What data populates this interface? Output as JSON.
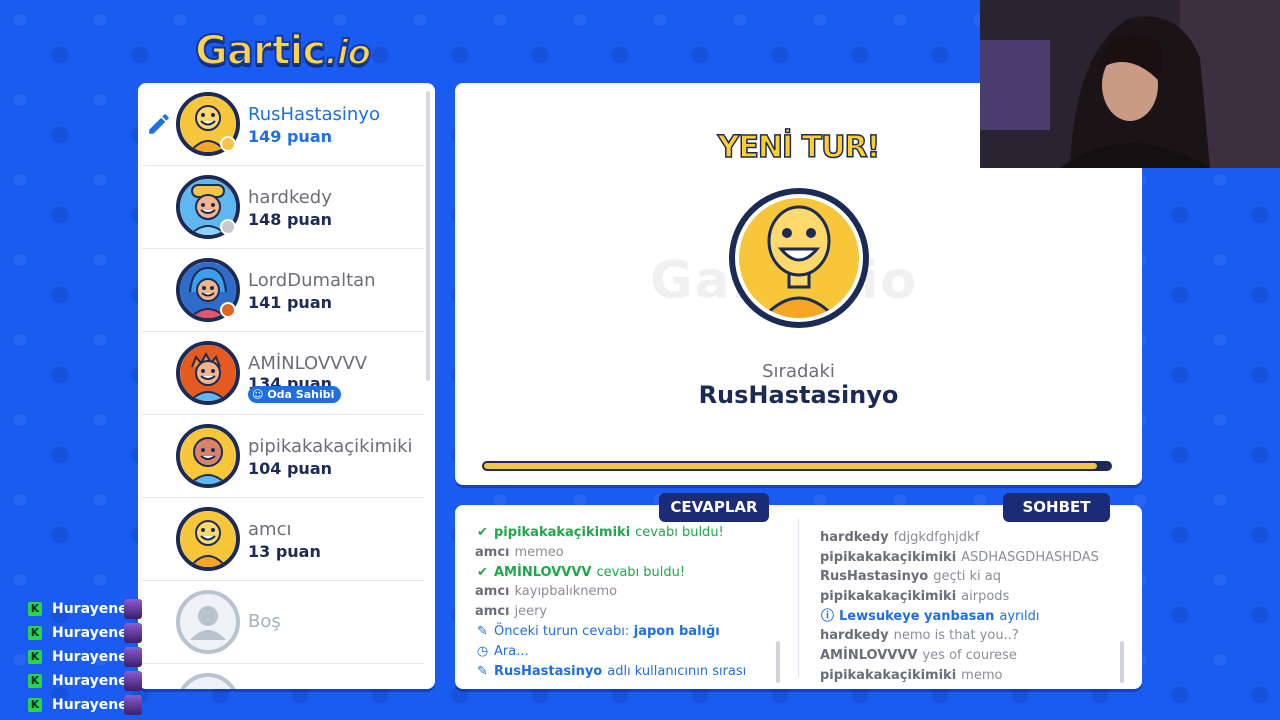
{
  "logo": {
    "text": "Gartic",
    "suffix": ".io"
  },
  "players": [
    {
      "name": "RusHastasinyo",
      "score": "149 puan",
      "drawing": true,
      "me": true,
      "avatar_color": "#f7c63b",
      "status_color": "#f4c542"
    },
    {
      "name": "hardkedy",
      "score": "148 puan",
      "avatar_color": "#5fb7ef",
      "status_color": "#c7c9cf"
    },
    {
      "name": "LordDumaltan",
      "score": "141 puan",
      "avatar_color": "#3b7fd6",
      "status_color": "#e0661f"
    },
    {
      "name": "AMİNLOVVVV",
      "score": "134 puan",
      "badge": "Oda Sahibi",
      "avatar_color": "#f08a2c"
    },
    {
      "name": "pipikakakaçikimiki",
      "score": "104 puan",
      "avatar_color": "#d9846a"
    },
    {
      "name": "amcı",
      "score": "13 puan",
      "avatar_color": "#f7c63b"
    },
    {
      "name": "Boş",
      "empty": true
    }
  ],
  "round": {
    "title": "YENİ TUR!",
    "next_label": "Sıradaki",
    "next_name": "RusHastasinyo",
    "progress": 0.98
  },
  "answers": {
    "label": "CEVAPLAR",
    "messages": [
      {
        "type": "success",
        "user": "pipikakakaçikimiki",
        "text": "cevabı buldu!"
      },
      {
        "type": "normal",
        "user": "amcı",
        "text": "memeo"
      },
      {
        "type": "success",
        "user": "AMİNLOVVVV",
        "text": "cevabı buldu!"
      },
      {
        "type": "normal",
        "user": "amcı",
        "text": "kayıpbalıknemo"
      },
      {
        "type": "normal",
        "user": "amcı",
        "text": "jeery"
      },
      {
        "type": "info-pencil",
        "text": "Önceki turun cevabı:",
        "strong": "japon balığı"
      },
      {
        "type": "info-clock",
        "text": "Ara..."
      },
      {
        "type": "info-pencil-user",
        "user": "RusHastasinyo",
        "text": "adlı kullanıcının sırası"
      }
    ]
  },
  "chat": {
    "label": "SOHBET",
    "messages": [
      {
        "type": "normal",
        "user": "hardkedy",
        "text": "fdjgkdfghjdkf"
      },
      {
        "type": "normal",
        "user": "pipikakakaçikimiki",
        "text": "ASDHASGDHASHDAS"
      },
      {
        "type": "normal",
        "user": "RusHastasinyo",
        "text": "geçti ki aq"
      },
      {
        "type": "normal",
        "user": "pipikakakaçikimiki",
        "text": "airpods"
      },
      {
        "type": "info-left",
        "user": "Lewsukeye yanbasan",
        "text": "ayrıldı"
      },
      {
        "type": "normal",
        "user": "hardkedy",
        "text": "nemo is that you..?"
      },
      {
        "type": "normal",
        "user": "AMİNLOVVVV",
        "text": "yes of courese"
      },
      {
        "type": "normal",
        "user": "pipikakakaçikimiki",
        "text": "memo"
      }
    ]
  },
  "stream_chat": {
    "badge": "K",
    "entries": [
      "Hurayene",
      "Hurayene",
      "Hurayene",
      "Hurayene",
      "Hurayene"
    ]
  }
}
